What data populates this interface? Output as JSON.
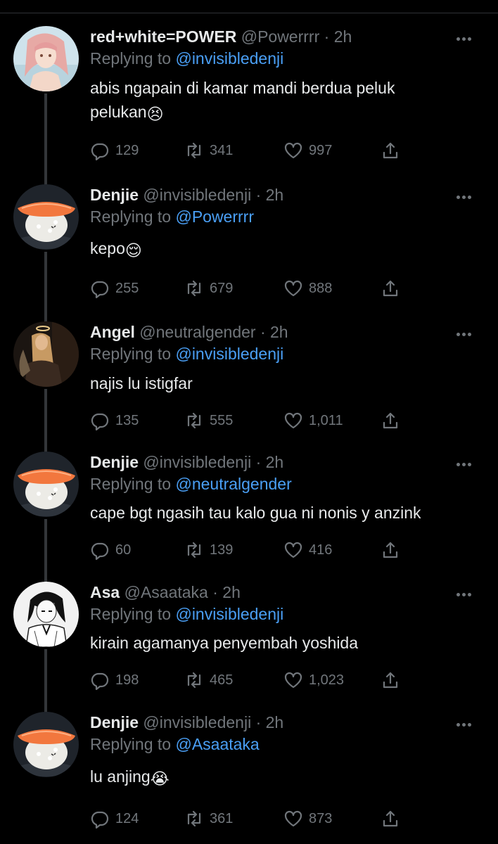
{
  "tweets": [
    {
      "name": "red+white=POWER",
      "handle": "@Powerrrr",
      "time": "· 2h",
      "replying_prefix": "Replying to",
      "replying_to": "@invisibledenji",
      "text_line1": "abis ngapain di kamar mandi berdua peluk",
      "text_line2": "pelukan",
      "emoji": "😣",
      "replies": "129",
      "retweets": "341",
      "likes": "997",
      "avatar": "anime-girl-avatar"
    },
    {
      "name": "Denjie",
      "handle": "@invisibledenji",
      "time": "· 2h",
      "replying_prefix": "Replying to",
      "replying_to": "@Powerrrr",
      "text_line1": "kepo",
      "emoji": "😌",
      "replies": "255",
      "retweets": "679",
      "likes": "888",
      "avatar": "salmon-sushi-avatar"
    },
    {
      "name": "Angel",
      "handle": "@neutralgender",
      "time": "· 2h",
      "replying_prefix": "Replying to",
      "replying_to": "@invisibledenji",
      "text_line1": "najis lu istigfar",
      "replies": "135",
      "retweets": "555",
      "likes": "1,011",
      "avatar": "dark-angel-avatar"
    },
    {
      "name": "Denjie",
      "handle": "@invisibledenji",
      "time": "· 2h",
      "replying_prefix": "Replying to",
      "replying_to": "@neutralgender",
      "text_line1": "cape bgt ngasih tau kalo gua ni nonis y anzink",
      "replies": "60",
      "retweets": "139",
      "likes": "416",
      "avatar": "salmon-sushi-avatar"
    },
    {
      "name": "Asa",
      "handle": "@Asaataka",
      "time": "· 2h",
      "replying_prefix": "Replying to",
      "replying_to": "@invisibledenji",
      "text_line1": "kirain agamanya penyembah yoshida",
      "replies": "198",
      "retweets": "465",
      "likes": "1,023",
      "avatar": "manga-girl-avatar"
    },
    {
      "name": "Denjie",
      "handle": "@invisibledenji",
      "time": "· 2h",
      "replying_prefix": "Replying to",
      "replying_to": "@Asaataka",
      "text_line1": "lu anjing",
      "emoji": "😭",
      "replies": "124",
      "retweets": "361",
      "likes": "873",
      "avatar": "salmon-sushi-avatar"
    }
  ],
  "colors": {
    "background": "#000000",
    "name": "#e7e9ea",
    "muted": "#71767b",
    "link": "#4a9ff5",
    "thread_line": "#333639"
  },
  "icons": [
    "reply-icon",
    "retweet-icon",
    "like-icon",
    "share-icon",
    "more-icon"
  ]
}
